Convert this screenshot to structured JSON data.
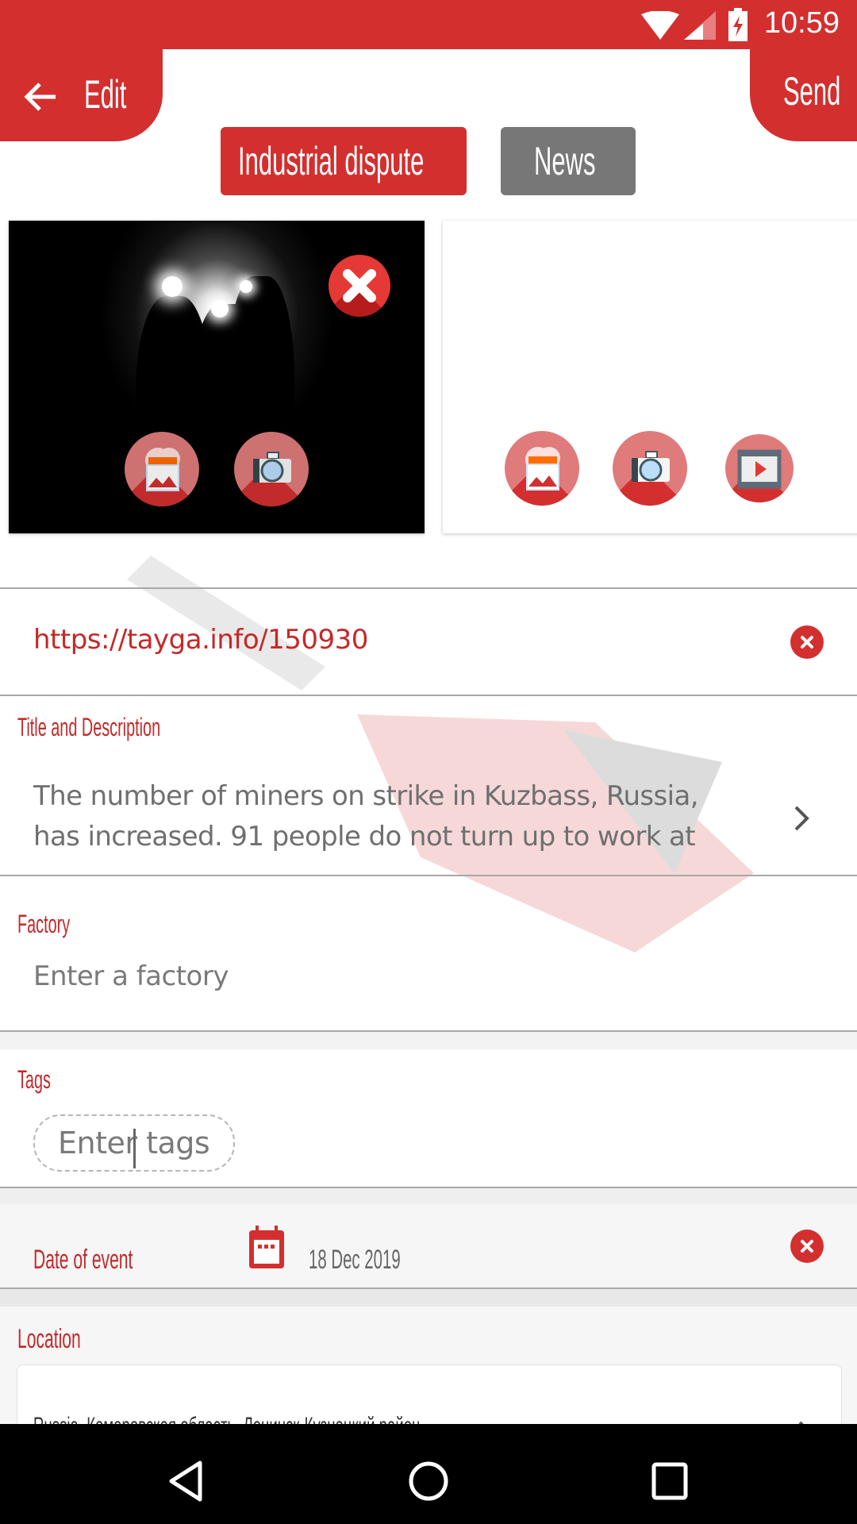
{
  "status_bar": {
    "time": "10:59",
    "icons": [
      "wifi-icon",
      "signal-icon",
      "battery-charging-icon"
    ]
  },
  "header": {
    "back_label": "Edit",
    "send_label": "Send"
  },
  "categories": [
    {
      "label": "Industrial dispute",
      "selected": true,
      "color": "#d32f2f"
    },
    {
      "label": "News",
      "selected": false,
      "color": "#777777"
    }
  ],
  "media": {
    "photo_card": {
      "description": "Miners silhouetted in a tunnel",
      "buttons": [
        "gallery-upload-icon",
        "camera-icon"
      ],
      "remove_icon": "remove-photo-icon"
    },
    "empty_card": {
      "buttons": [
        "gallery-upload-icon",
        "camera-icon",
        "video-icon"
      ]
    }
  },
  "link": {
    "value": "https://tayga.info/150930"
  },
  "title_description": {
    "label": "Title and Description",
    "line1": "The number of miners on strike in Kuzbass, Russia,",
    "line2": "has increased. 91 people do not turn up to work at"
  },
  "factory": {
    "label": "Factory",
    "placeholder": "Enter a factory"
  },
  "tags": {
    "label": "Tags",
    "placeholder": "Enter tags"
  },
  "date": {
    "label": "Date of event",
    "value": "18 Dec 2019"
  },
  "location": {
    "label": "Location",
    "value": "Russia, Кемеровская область, Ленинск-Кузнецкий район"
  },
  "colors": {
    "accent": "#d32f2f",
    "accent_light": "#e07b7b",
    "category_inactive": "#777777"
  },
  "nav_bar": {
    "buttons": [
      "back",
      "home",
      "recents"
    ]
  }
}
